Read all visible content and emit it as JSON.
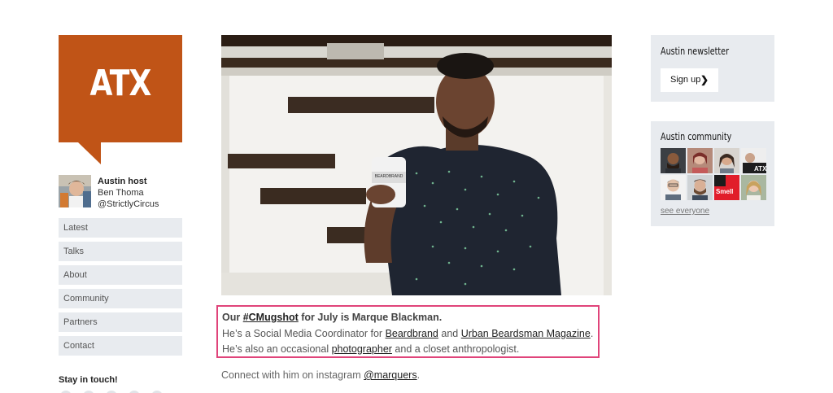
{
  "logo": {
    "text": "ATX"
  },
  "host": {
    "title": "Austin host",
    "name": "Ben Thoma",
    "handle": "@StrictlyCircus"
  },
  "nav": {
    "items": [
      "Latest",
      "Talks",
      "About",
      "Community",
      "Partners",
      "Contact"
    ]
  },
  "stay_in_touch": "Stay in touch!",
  "hero": {
    "mug_label": "BEARDBRAND"
  },
  "caption": {
    "line1_prefix": "Our ",
    "hashtag": "#CMugshot",
    "line1_suffix": " for July is Marque Blackman.",
    "line2_prefix": "He’s a Social Media Coordinator for ",
    "link_beardbrand": "Beardbrand",
    "line2_mid": " and ",
    "link_magazine": "Urban Beardsman Magazine",
    "line2_suffix": ".",
    "line3_prefix": "He’s also an occasional ",
    "link_photographer": "photographer",
    "line3_suffix": " and a closet anthropologist."
  },
  "connect": {
    "prefix": "Connect with him on instagram ",
    "handle": "@marquers",
    "suffix": "."
  },
  "newsletter": {
    "title": "Austin newsletter",
    "signup_label": "Sign up",
    "chevron": "❯"
  },
  "community": {
    "title": "Austin community",
    "see_everyone": "see everyone",
    "tile_text": "Smell"
  },
  "colors": {
    "brand": "#c05417",
    "highlight_border": "#e0447a",
    "panel_bg": "#e8ebef"
  }
}
